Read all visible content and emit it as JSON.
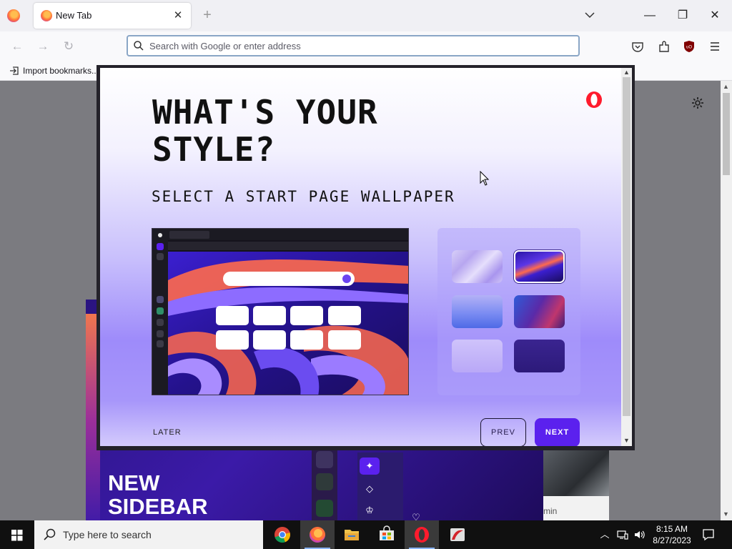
{
  "browser": {
    "tab_title": "New Tab",
    "tab_close": "✕",
    "new_tab": "+",
    "url_placeholder": "Search with Google or enter address",
    "bookmark_import": "Import bookmarks..."
  },
  "page": {
    "promo_title_line1": "NEW",
    "promo_title_line2": "SIDEBAR",
    "thumb_caption": "min"
  },
  "modal": {
    "title": "WHAT'S YOUR STYLE?",
    "subtitle": "SELECT A START PAGE WALLPAPER",
    "later": "LATER",
    "prev": "PREV",
    "next": "NEXT",
    "selected_wallpaper_index": 1,
    "wallpapers": [
      "pastel-swirl",
      "purple-swirl",
      "blue-lilac-gradient",
      "dark-aurora",
      "lilac-soft",
      "deep-indigo"
    ]
  },
  "taskbar": {
    "search_placeholder": "Type here to search",
    "time": "8:15 AM",
    "date": "8/27/2023"
  },
  "colors": {
    "accent": "#5b21ee",
    "opera_red": "#ff1b2d"
  }
}
